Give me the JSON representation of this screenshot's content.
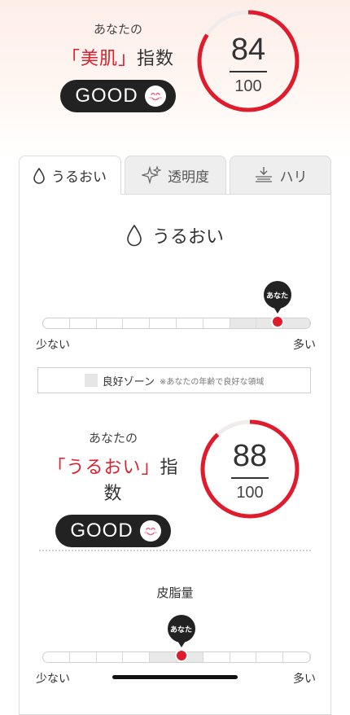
{
  "hero": {
    "you_label": "あなたの",
    "index_prefix": "「美肌」",
    "index_suffix": "指数",
    "good_label": "GOOD",
    "score": "84",
    "score_fraction": 0.84,
    "max": "100"
  },
  "tabs": [
    {
      "label": "うるおい",
      "icon": "water-drop-icon",
      "active": true
    },
    {
      "label": "透明度",
      "icon": "sparkle-icon",
      "active": false
    },
    {
      "label": "ハリ",
      "icon": "firmness-icon",
      "active": false
    }
  ],
  "moisture": {
    "title": "うるおい",
    "bubble_label": "あなた",
    "scale_position": 0.88,
    "zone_start": 0.7,
    "zone_end": 1.0,
    "low_label": "少ない",
    "high_label": "多い",
    "legend_label": "良好ゾーン",
    "legend_note": "※あなたの年齢で良好な領域",
    "you_label": "あなたの",
    "index_prefix": "「うるおい」",
    "index_suffix": "指数",
    "good_label": "GOOD",
    "score": "88",
    "score_fraction": 0.88,
    "max": "100"
  },
  "sebum": {
    "title": "皮脂量",
    "bubble_label": "あなた",
    "scale_position": 0.52,
    "zone_start": 0.35,
    "zone_end": 0.65,
    "low_label": "少ない",
    "high_label": "多い"
  },
  "colors": {
    "accent": "#d9212f",
    "dark": "#222222",
    "zone": "#e8e8e8"
  }
}
